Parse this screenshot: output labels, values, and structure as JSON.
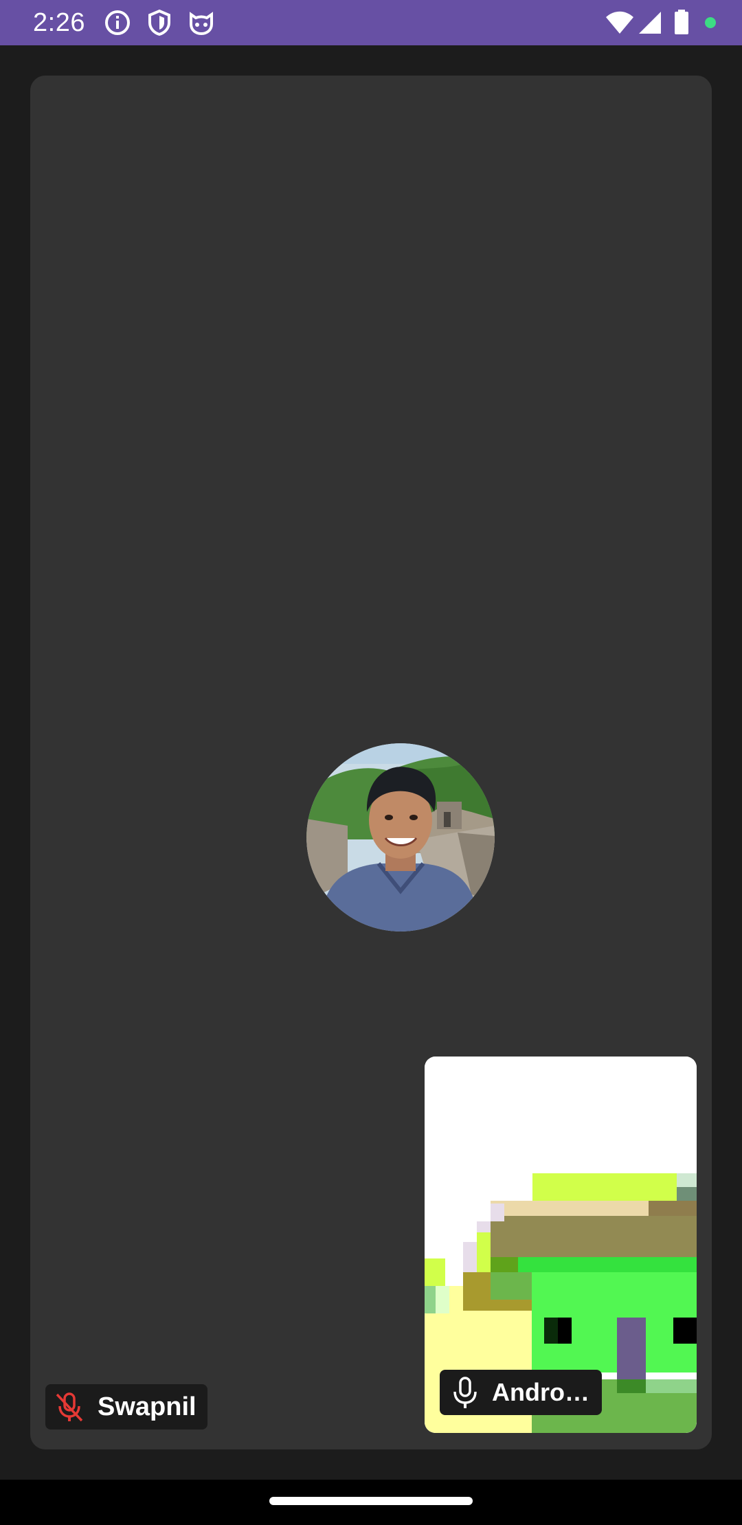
{
  "status_bar": {
    "time": "2:26",
    "icons_left": [
      "info-icon",
      "shield-icon",
      "cat-face-icon"
    ],
    "icons_right": [
      "wifi-icon",
      "signal-icon",
      "battery-icon",
      "green-dot-indicator"
    ],
    "background": "#6750a4"
  },
  "main_tile": {
    "participant_name": "Swapnil",
    "mic_state": "muted",
    "mic_icon": "mic-off-icon",
    "mic_color": "#e53935",
    "avatar": "profile-photo"
  },
  "pip_tile": {
    "participant_name": "Andro…",
    "mic_state": "on",
    "mic_icon": "mic-icon",
    "video": "pixel-art-video"
  },
  "nav_bar": {
    "handle": "home-handle"
  }
}
